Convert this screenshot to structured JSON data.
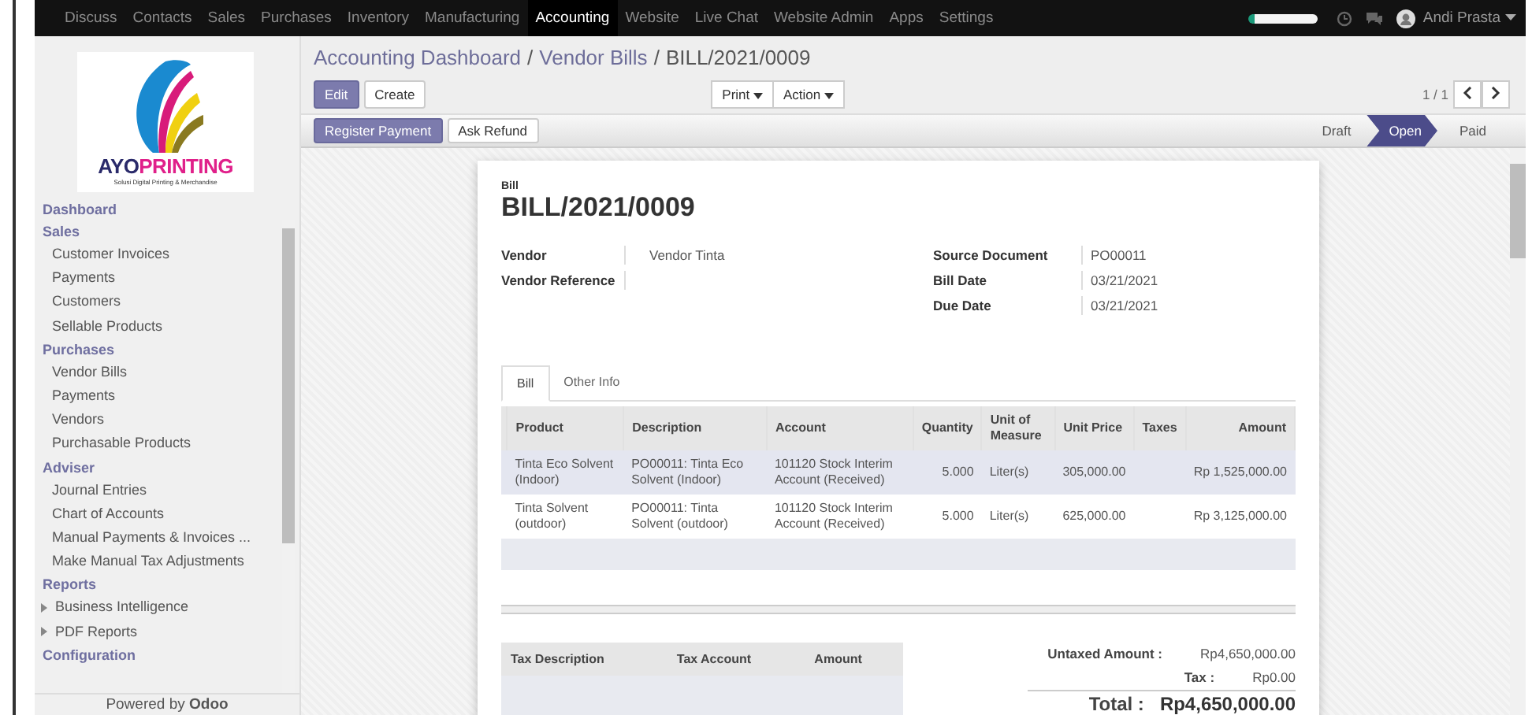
{
  "topbar": {
    "apps": [
      {
        "label": "Discuss",
        "selected": false
      },
      {
        "label": "Contacts",
        "selected": false
      },
      {
        "label": "Sales",
        "selected": false
      },
      {
        "label": "Purchases",
        "selected": false
      },
      {
        "label": "Inventory",
        "selected": false
      },
      {
        "label": "Manufacturing",
        "selected": false
      },
      {
        "label": "Accounting",
        "selected": true
      },
      {
        "label": "Website",
        "selected": false
      },
      {
        "label": "Live Chat",
        "selected": false
      },
      {
        "label": "Website Admin",
        "selected": false
      },
      {
        "label": "Apps",
        "selected": false
      },
      {
        "label": "Settings",
        "selected": false
      }
    ],
    "user": "Andi Prasta"
  },
  "sidebar": {
    "logo": {
      "brand_a": "AYO",
      "brand_b": "PRINTING",
      "tagline": "Solusi Digital Printing & Merchandise"
    },
    "sections": [
      {
        "title": "Dashboard"
      },
      {
        "title": "Sales",
        "items": [
          {
            "label": "Customer Invoices"
          },
          {
            "label": "Payments"
          },
          {
            "label": "Customers"
          },
          {
            "label": "Sellable Products"
          }
        ]
      },
      {
        "title": "Purchases",
        "items": [
          {
            "label": "Vendor Bills"
          },
          {
            "label": "Payments"
          },
          {
            "label": "Vendors"
          },
          {
            "label": "Purchasable Products"
          }
        ]
      },
      {
        "title": "Adviser",
        "items": [
          {
            "label": "Journal Entries"
          },
          {
            "label": "Chart of Accounts"
          },
          {
            "label": "Manual Payments & Invoices ..."
          },
          {
            "label": "Make Manual Tax Adjustments"
          }
        ]
      },
      {
        "title": "Reports",
        "items": [
          {
            "label": "Business Intelligence",
            "expanded": false
          },
          {
            "label": "PDF Reports",
            "expanded": false
          }
        ]
      },
      {
        "title": "Configuration"
      }
    ],
    "footer": "Powered by **Odoo**"
  },
  "breadcrumbs": [
    "Accounting Dashboard",
    "Vendor Bills",
    "BILL/2021/0009"
  ],
  "breadcrumb_separator": "/",
  "buttons": {
    "primary": "Edit",
    "secondary": "Create",
    "print": "Print",
    "action": "Action"
  },
  "pager": "1 / 1",
  "statusbar": {
    "actions": [
      {
        "label": "Register Payment",
        "kind": "primary"
      },
      {
        "label": "Ask Refund",
        "kind": "default"
      }
    ],
    "stages": [
      {
        "label": "Draft",
        "selected": false
      },
      {
        "label": "Open",
        "selected": true
      },
      {
        "label": "Paid",
        "selected": false
      }
    ]
  },
  "sheet": {
    "label": "Bill",
    "title": "BILL/2021/0009",
    "left_fields": [
      {
        "label": "Vendor",
        "value": "Vendor Tinta"
      },
      {
        "label": "Vendor Reference"
      }
    ],
    "right_fields": [
      {
        "label": "Source Document",
        "value": "PO00011"
      },
      {
        "label": "Bill Date",
        "value": "03/21/2021"
      },
      {
        "label": "Due Date",
        "value": "03/21/2021"
      }
    ],
    "tabs": [
      {
        "label": "Bill",
        "selected": true
      },
      {
        "label": "Other Info",
        "selected": false
      }
    ],
    "lines": {
      "columns": [
        "Product",
        "Description",
        "Account",
        "Quantity",
        "Unit of Measure",
        "Unit Price",
        "Taxes",
        "Amount"
      ],
      "rows": [
        {
          "selected": true,
          "cells": [
            "Tinta Eco Solvent (Indoor)",
            "PO00011: Tinta Eco Solvent (Indoor)",
            "101120 Stock Interim Account (Received)",
            "5.000",
            "Liter(s)",
            "305,000.00",
            "",
            "Rp 1,525,000.00"
          ]
        },
        {
          "selected": false,
          "cells": [
            "Tinta Solvent (outdoor)",
            "PO00011: Tinta Solvent (outdoor)",
            "101120 Stock Interim Account (Received)",
            "5.000",
            "Liter(s)",
            "625,000.00",
            "",
            "Rp 3,125,000.00"
          ]
        }
      ]
    },
    "tax_columns": [
      "Tax Description",
      "Tax Account",
      "Amount"
    ],
    "totals": [
      {
        "label": "Untaxed Amount :",
        "value": "Rp4,650,000.00",
        "kind": "normal"
      },
      {
        "label": "Tax :",
        "value": "Rp0.00",
        "kind": "normal"
      },
      {
        "label": "Total :",
        "value": "Rp4,650,000.00",
        "kind": "grand"
      }
    ]
  }
}
